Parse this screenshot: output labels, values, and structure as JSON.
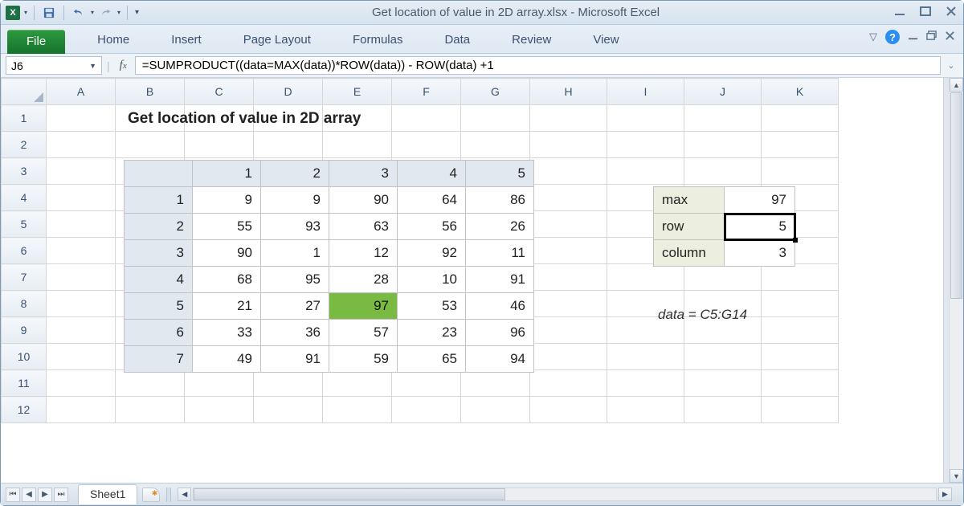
{
  "window": {
    "title": "Get location of value in 2D array.xlsx  -  Microsoft Excel"
  },
  "ribbon": {
    "file": "File",
    "tabs": [
      "Home",
      "Insert",
      "Page Layout",
      "Formulas",
      "Data",
      "Review",
      "View"
    ]
  },
  "namebox": "J6",
  "formula": "=SUMPRODUCT((data=MAX(data))*ROW(data)) - ROW(data) +1",
  "columns": [
    "A",
    "B",
    "C",
    "D",
    "E",
    "F",
    "G",
    "H",
    "I",
    "J",
    "K"
  ],
  "rows": [
    "1",
    "2",
    "3",
    "4",
    "5",
    "6",
    "7",
    "8",
    "9",
    "10",
    "11",
    "12"
  ],
  "highlight_col_index": 9,
  "highlight_row_index": 5,
  "heading": "Get location of value in 2D array",
  "data_table": {
    "col_headers": [
      "1",
      "2",
      "3",
      "4",
      "5"
    ],
    "row_headers": [
      "1",
      "2",
      "3",
      "4",
      "5",
      "6",
      "7"
    ],
    "values": [
      [
        9,
        9,
        90,
        64,
        86
      ],
      [
        55,
        93,
        63,
        56,
        26
      ],
      [
        90,
        1,
        12,
        92,
        11
      ],
      [
        68,
        95,
        28,
        10,
        91
      ],
      [
        21,
        27,
        97,
        53,
        46
      ],
      [
        33,
        36,
        57,
        23,
        96
      ],
      [
        49,
        91,
        59,
        65,
        94
      ]
    ],
    "max_row": 4,
    "max_col": 2
  },
  "results": {
    "labels": {
      "max": "max",
      "row": "row",
      "col": "column"
    },
    "values": {
      "max": 97,
      "row": 5,
      "col": 3
    }
  },
  "note": "data = C5:G14",
  "sheet_tab": "Sheet1"
}
